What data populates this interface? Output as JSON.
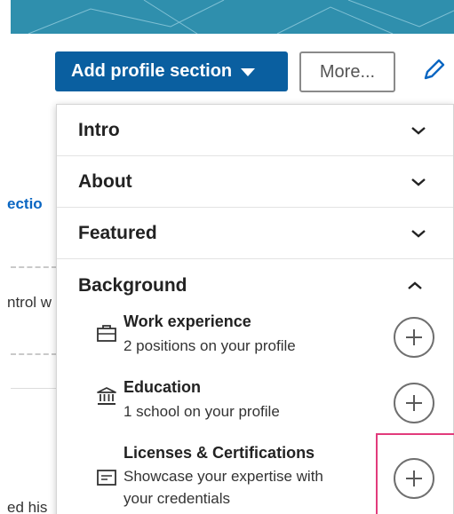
{
  "toolbar": {
    "add_profile_section_label": "Add profile section",
    "more_label": "More...",
    "edit_icon": "pencil-icon"
  },
  "background_fragments": {
    "section_link": "ectio",
    "control_text": "ntrol w",
    "bottom_text": "ed his"
  },
  "dropdown": {
    "sections": [
      {
        "label": "Intro",
        "state": "collapsed"
      },
      {
        "label": "About",
        "state": "collapsed"
      },
      {
        "label": "Featured",
        "state": "collapsed"
      }
    ],
    "background": {
      "label": "Background",
      "state": "expanded",
      "items": [
        {
          "icon": "briefcase-icon",
          "title": "Work experience",
          "subtitle": "2 positions on your profile"
        },
        {
          "icon": "school-icon",
          "title": "Education",
          "subtitle": "1 school on your profile"
        },
        {
          "icon": "certificate-icon",
          "title": "Licenses & Certifications",
          "subtitle_line1": "Showcase your expertise with",
          "subtitle_line2": "your credentials"
        }
      ]
    }
  },
  "colors": {
    "primary_button": "#0a5fa0",
    "banner": "#2f8fad",
    "highlight": "#e23b7c",
    "link": "#0a66c2"
  }
}
